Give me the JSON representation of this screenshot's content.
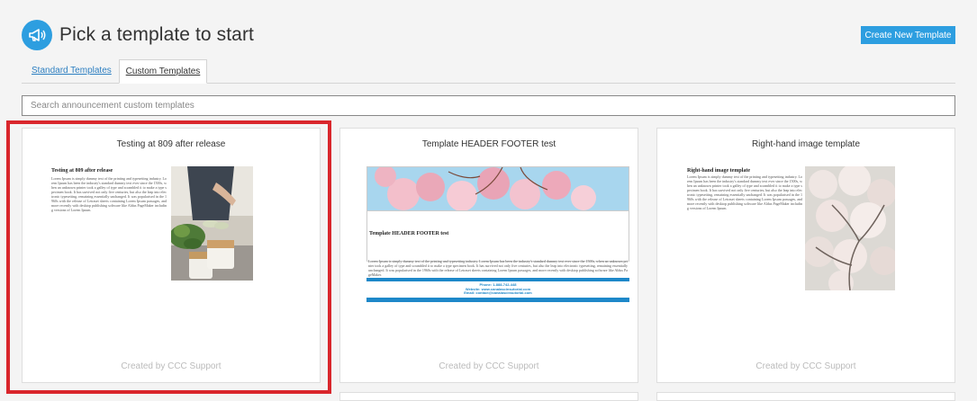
{
  "header": {
    "title": "Pick a template to start",
    "logo_icon": "megaphone-icon",
    "create_button": "Create New Template"
  },
  "tabs": [
    {
      "label": "Standard Templates",
      "active": false
    },
    {
      "label": "Custom Templates",
      "active": true
    }
  ],
  "search": {
    "placeholder": "Search announcement custom templates",
    "value": ""
  },
  "colors": {
    "accent": "#2d9ee0",
    "highlight": "#d9262c",
    "footer_bar": "#1e88c9"
  },
  "cards": [
    {
      "title": "Testing at 809 after release",
      "footer": "Created by CCC Support",
      "selected": true,
      "preview": {
        "heading": "Testing at 809 after release",
        "body": "Lorem Ipsum is simply dummy text of the printing and typesetting industry. Lorem Ipsum has been the industry's standard dummy text ever since the 1500s, when an unknown printer took a galley of type and scrambled it to make a type specimen book. It has survived not only five centuries, but also the leap into electronic typesetting, remaining essentially unchanged. It was popularised in the 1960s with the release of Letraset sheets containing Lorem Ipsum passages, and more recently with desktop publishing software like Aldus PageMaker including versions of Lorem Ipsum."
      }
    },
    {
      "title": "Template HEADER FOOTER test",
      "footer": "Created by CCC Support",
      "selected": false,
      "preview": {
        "heading": "Template HEADER FOOTER test",
        "body": "Lorem Ipsum is simply dummy text of the printing and typesetting industry. Lorem Ipsum has been the industry's standard dummy text ever since the 1500s, when an unknown printer took a galley of type and scrambled it to make a type specimen book. It has survived not only five centuries, but also the leap into electronic typesetting, remaining essentially unchanged. It was popularised in the 1960s with the release of Letraset sheets containing Lorem Ipsum passages, and more recently with desktop publishing software like Aldus PageMaker.",
        "footer_lines": [
          "Phone: 1-888-742-448",
          "Website: www.canalascinsutorial.com",
          "Email: contact@canalascinsutorial.com"
        ]
      }
    },
    {
      "title": "Right-hand image template",
      "footer": "Created by CCC Support",
      "selected": false,
      "preview": {
        "heading": "Right-hand image template",
        "body": "Lorem Ipsum is simply dummy text of the printing and typesetting industry. Lorem Ipsum has been the industry's standard dummy text ever since the 1500s, when an unknown printer took a galley of type and scrambled it to make a type specimen book. It has survived not only five centuries, but also the leap into electronic typesetting, remaining essentially unchanged. It was popularised in the 1960s with the release of Letraset sheets containing Lorem Ipsum passages, and more recently with desktop publishing software like Aldus PageMaker including versions of Lorem Ipsum."
      }
    }
  ]
}
